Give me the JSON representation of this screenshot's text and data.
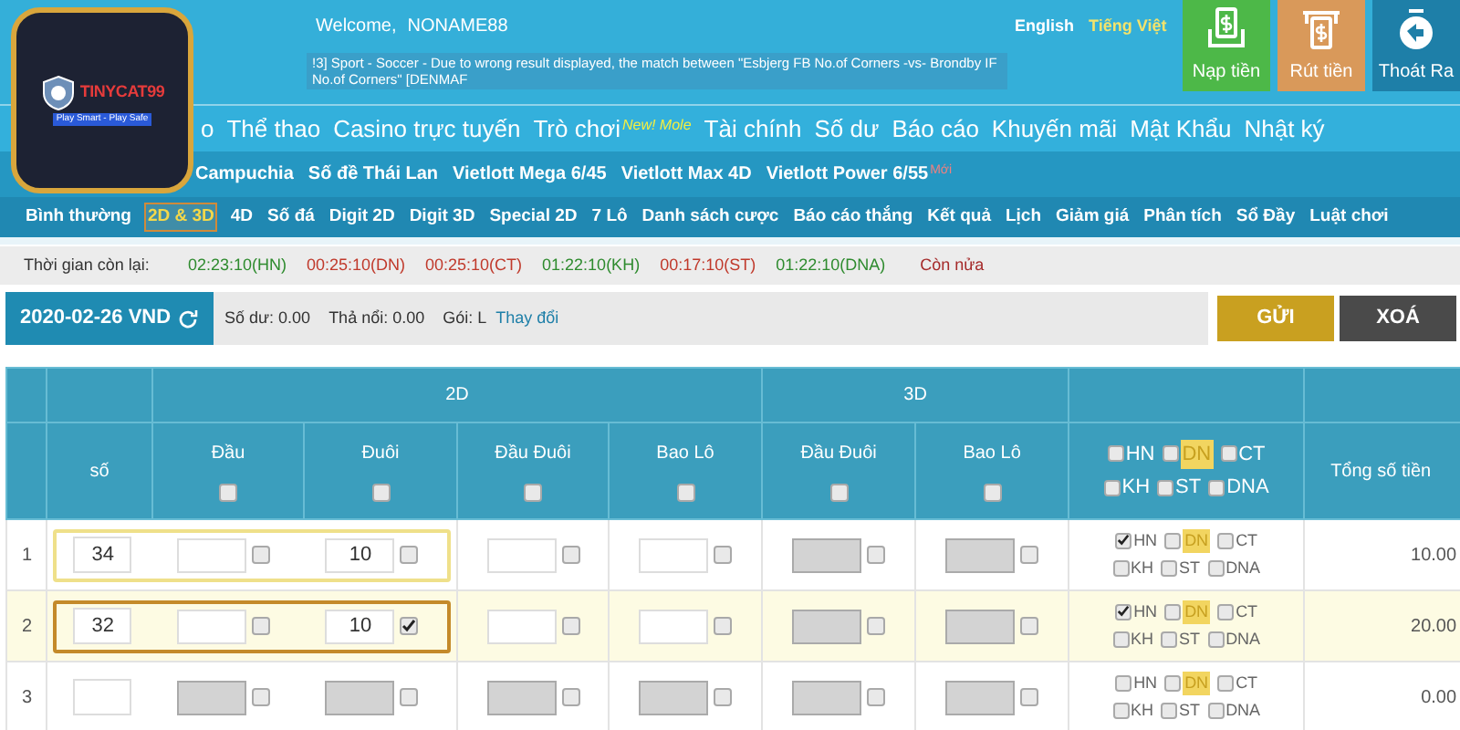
{
  "logo": {
    "title": "TINYCAT99",
    "tagline": "Play Smart - Play Safe"
  },
  "welcome": {
    "label": "Welcome,",
    "user": "NONAME88"
  },
  "ticker": "!3] Sport - Soccer - Due to wrong result displayed, the match between \"Esbjerg FB No.of Corners -vs- Brondby IF No.of Corners\" [DENMAF",
  "languages": [
    {
      "label": "English",
      "selected": false
    },
    {
      "label": "Tiếng Việt",
      "selected": true
    }
  ],
  "header_buttons": [
    {
      "kind": "deposit",
      "label": "Nạp tiền"
    },
    {
      "kind": "withdraw",
      "label": "Rút tiền"
    },
    {
      "kind": "logout",
      "label": "Thoát Ra"
    }
  ],
  "main_nav": [
    {
      "label": "o"
    },
    {
      "label": "Thể thao"
    },
    {
      "label": "Casino trực tuyến"
    },
    {
      "label": "Trò chơi",
      "badge": "New! Mole"
    },
    {
      "label": "Tài chính"
    },
    {
      "label": "Số dư"
    },
    {
      "label": "Báo cáo"
    },
    {
      "label": "Khuyến mãi"
    },
    {
      "label": "Mật Khẩu"
    },
    {
      "label": "Nhật ký"
    }
  ],
  "lottery_nav": [
    {
      "label": "Campuchia"
    },
    {
      "label": "Số đề Thái Lan"
    },
    {
      "label": "Vietlott Mega 6/45"
    },
    {
      "label": "Vietlott Max 4D"
    },
    {
      "label": "Vietlott Power 6/55",
      "badge": "Mới"
    }
  ],
  "sub_nav": [
    {
      "label": "Bình thường",
      "selected": false
    },
    {
      "label": "2D & 3D",
      "selected": true
    },
    {
      "label": "4D",
      "selected": false
    },
    {
      "label": "Số đá",
      "selected": false
    },
    {
      "label": "Digit 2D",
      "selected": false
    },
    {
      "label": "Digit 3D",
      "selected": false
    },
    {
      "label": "Special 2D",
      "selected": false
    },
    {
      "label": "7 Lô",
      "selected": false
    },
    {
      "label": "Danh sách cược",
      "selected": false
    },
    {
      "label": "Báo cáo thắng",
      "selected": false
    },
    {
      "label": "Kết quả",
      "selected": false
    },
    {
      "label": "Lịch",
      "selected": false
    },
    {
      "label": "Giảm giá",
      "selected": false
    },
    {
      "label": "Phân tích",
      "selected": false
    },
    {
      "label": "Sổ Đầy",
      "selected": false
    },
    {
      "label": "Luật chơi",
      "selected": false
    }
  ],
  "timers": {
    "label": "Thời gian còn lại:",
    "items": [
      {
        "text": "02:23:10(HN)",
        "color": "#2e8b2e"
      },
      {
        "text": "00:25:10(DN)",
        "color": "#c0392b"
      },
      {
        "text": "00:25:10(CT)",
        "color": "#c0392b"
      },
      {
        "text": "01:22:10(KH)",
        "color": "#2e8b2e"
      },
      {
        "text": "00:17:10(ST)",
        "color": "#c0392b"
      },
      {
        "text": "01:22:10(DNA)",
        "color": "#2e8b2e"
      }
    ],
    "more": "Còn nửa"
  },
  "account": {
    "date": "2020-02-26 VND",
    "balance": "Số dư: 0.00",
    "float": "Thả nổi: 0.00",
    "package": "Gói: L",
    "change_link": "Thay đổi"
  },
  "actions": [
    {
      "kind": "submit",
      "label": "GỬI"
    },
    {
      "kind": "clear",
      "label": "XOÁ"
    }
  ],
  "table": {
    "group_2d": "2D",
    "group_3d": "3D",
    "number_column": "số",
    "columns_2d": [
      {
        "label": "Đầu",
        "checked": false
      },
      {
        "label": "Đuôi",
        "checked": false
      },
      {
        "label": "Đầu Đuôi",
        "checked": false
      },
      {
        "label": "Bao Lô",
        "checked": false
      }
    ],
    "columns_3d": [
      {
        "label": "Đầu Đuôi",
        "checked": false
      },
      {
        "label": "Bao Lô",
        "checked": false
      }
    ],
    "total_column": "Tổng số tiền",
    "regions": [
      {
        "label": "HN",
        "checked": false,
        "highlighted": false
      },
      {
        "label": "DN",
        "checked": false,
        "highlighted": true
      },
      {
        "label": "CT",
        "checked": false,
        "highlighted": false
      },
      {
        "label": "KH",
        "checked": false,
        "highlighted": false
      },
      {
        "label": "ST",
        "checked": false,
        "highlighted": false
      },
      {
        "label": "DNA",
        "checked": false,
        "highlighted": false
      }
    ],
    "rows": [
      {
        "index": "1",
        "selected": false,
        "focused": true,
        "number": "34",
        "cells_2d": [
          {
            "checked": false,
            "disabled": false
          },
          {
            "value": "10",
            "checked": false,
            "disabled": false
          },
          {
            "checked": false,
            "disabled": false
          },
          {
            "checked": false,
            "disabled": false
          }
        ],
        "cells_3d": [
          {
            "checked": false,
            "disabled": true
          },
          {
            "checked": false,
            "disabled": true
          }
        ],
        "regions": [
          {
            "label": "HN",
            "checked": true
          },
          {
            "label": "DN",
            "checked": false
          },
          {
            "label": "CT",
            "checked": false
          },
          {
            "label": "KH",
            "checked": false
          },
          {
            "label": "ST",
            "checked": false
          },
          {
            "label": "DNA",
            "checked": false
          }
        ],
        "total": "10.00"
      },
      {
        "index": "2",
        "selected": true,
        "focused": false,
        "number": "32",
        "cells_2d": [
          {
            "checked": false,
            "disabled": false
          },
          {
            "value": "10",
            "checked": true,
            "disabled": false
          },
          {
            "checked": false,
            "disabled": false
          },
          {
            "checked": false,
            "disabled": false
          }
        ],
        "cells_3d": [
          {
            "checked": false,
            "disabled": true
          },
          {
            "checked": false,
            "disabled": true
          }
        ],
        "regions": [
          {
            "label": "HN",
            "checked": true
          },
          {
            "label": "DN",
            "checked": false
          },
          {
            "label": "CT",
            "checked": false
          },
          {
            "label": "KH",
            "checked": false
          },
          {
            "label": "ST",
            "checked": false
          },
          {
            "label": "DNA",
            "checked": false
          }
        ],
        "total": "20.00"
      },
      {
        "index": "3",
        "selected": false,
        "focused": false,
        "cells_2d": [
          {
            "checked": false,
            "disabled": true
          },
          {
            "checked": false,
            "disabled": true
          },
          {
            "checked": false,
            "disabled": true
          },
          {
            "checked": false,
            "disabled": true
          }
        ],
        "cells_3d": [
          {
            "checked": false,
            "disabled": true
          },
          {
            "checked": false,
            "disabled": true
          }
        ],
        "regions": [
          {
            "label": "HN",
            "checked": false
          },
          {
            "label": "DN",
            "checked": false
          },
          {
            "label": "CT",
            "checked": false
          },
          {
            "label": "KH",
            "checked": false
          },
          {
            "label": "ST",
            "checked": false
          },
          {
            "label": "DNA",
            "checked": false
          }
        ],
        "total": "0.00"
      }
    ]
  }
}
